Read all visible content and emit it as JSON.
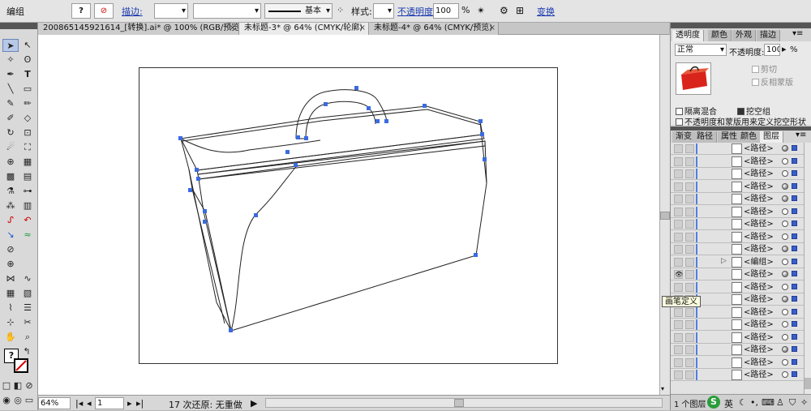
{
  "control_bar": {
    "selection_label": "编组",
    "stroke_link": "描边:",
    "stroke_weight": "",
    "brush_label": "基本",
    "style_label": "样式:",
    "opacity_link": "不透明度:",
    "opacity_value": "100",
    "opacity_unit": "%",
    "transform_link": "变换"
  },
  "tabs": [
    {
      "label": "200865145921614_[转换].ai* @ 100% (RGB/预览)"
    },
    {
      "label": "未标题-3* @ 64% (CMYK/轮廓)"
    },
    {
      "label": "未标题-4* @ 64% (CMYK/预览)"
    }
  ],
  "status_bar": {
    "zoom": "64%",
    "page": "1",
    "undo_text": "17 次还原: 无重做"
  },
  "transparency_panel": {
    "tabs": [
      "透明度",
      "颜色",
      "外观",
      "描边"
    ],
    "blend_mode": "正常",
    "opacity_label": "不透明度:",
    "opacity_value": "100",
    "opacity_unit": "%",
    "clip_label": "剪切",
    "invert_mask_label": "反相蒙版",
    "isolate_blending_label": "隔离混合",
    "knockout_group_label": "挖空组",
    "opacity_mask_label": "不透明度和蒙版用来定义挖空形状"
  },
  "layers_panel": {
    "tabs": [
      "渐变",
      "路径",
      "属性",
      "颜色",
      "图层"
    ],
    "rows": [
      {
        "name": "<路径>",
        "filled": true
      },
      {
        "name": "<路径>",
        "filled": false
      },
      {
        "name": "<路径>",
        "filled": false
      },
      {
        "name": "<路径>",
        "filled": true
      },
      {
        "name": "<路径>",
        "filled": true
      },
      {
        "name": "<路径>",
        "filled": false
      },
      {
        "name": "<路径>",
        "filled": false
      },
      {
        "name": "<路径>",
        "filled": false
      },
      {
        "name": "<路径>",
        "filled": true
      },
      {
        "name": "<编组>",
        "filled": false
      },
      {
        "name": "<路径>",
        "filled": true
      },
      {
        "name": "<路径>",
        "filled": false
      },
      {
        "name": "<路径>",
        "filled": true
      },
      {
        "name": "<路径>",
        "filled": false
      },
      {
        "name": "<路径>",
        "filled": false
      },
      {
        "name": "<路径>",
        "filled": false
      },
      {
        "name": "<路径>",
        "filled": true
      },
      {
        "name": "<路径>",
        "filled": false
      },
      {
        "name": "<路径>",
        "filled": false
      }
    ],
    "footer_label": "1 个图层",
    "tooltip": "画笔定义"
  },
  "colors": {
    "selection_blue": "#3a6be0",
    "link_blue": "#1a3ab0",
    "case_red": "#d9241c"
  }
}
